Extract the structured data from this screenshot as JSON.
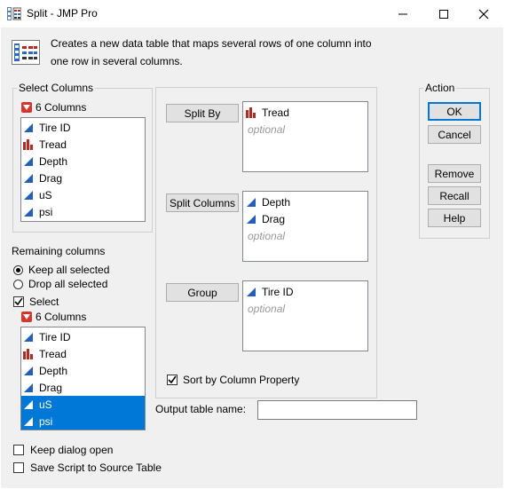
{
  "window": {
    "title": "Split - JMP Pro",
    "icon": "split-table-icon"
  },
  "description": {
    "line1": "Creates a new data table that maps several rows of one column into",
    "line2": "one row in several columns."
  },
  "select_columns": {
    "group_title": "Select Columns",
    "count_label": "6 Columns",
    "items": [
      {
        "label": "Tire ID",
        "icon": "continuous-icon"
      },
      {
        "label": "Tread",
        "icon": "nominal-bar-icon"
      },
      {
        "label": "Depth",
        "icon": "continuous-icon"
      },
      {
        "label": "Drag",
        "icon": "continuous-icon"
      },
      {
        "label": "uS",
        "icon": "continuous-icon"
      },
      {
        "label": "psi",
        "icon": "continuous-icon"
      }
    ]
  },
  "remaining": {
    "label": "Remaining columns",
    "keep_label": "Keep all selected",
    "drop_label": "Drop all selected",
    "select_label": "Select",
    "count_label": "6 Columns",
    "items": [
      {
        "label": "Tire ID",
        "selected": false
      },
      {
        "label": "Tread",
        "selected": false
      },
      {
        "label": "Depth",
        "selected": false
      },
      {
        "label": "Drag",
        "selected": false
      },
      {
        "label": "uS",
        "selected": true
      },
      {
        "label": "psi",
        "selected": true
      }
    ]
  },
  "roles": {
    "split_by": {
      "label": "Split By",
      "items": [
        "Tread"
      ],
      "placeholder": "optional"
    },
    "split_columns": {
      "label": "Split Columns",
      "items": [
        "Depth",
        "Drag"
      ],
      "placeholder": "optional"
    },
    "group": {
      "label": "Group",
      "items": [
        "Tire ID"
      ],
      "placeholder": "optional"
    },
    "sort_label": "Sort by Column Property"
  },
  "output": {
    "label": "Output table name:",
    "value": ""
  },
  "action": {
    "group_title": "Action",
    "ok": "OK",
    "cancel": "Cancel",
    "remove": "Remove",
    "recall": "Recall",
    "help": "Help"
  },
  "bottom": {
    "keep_open": "Keep dialog open",
    "save_script": "Save Script to Source Table"
  },
  "colors": {
    "continuous_icon": "#1f5fbf",
    "nominal_icon": "#c0261c",
    "selection": "#0078d7"
  }
}
